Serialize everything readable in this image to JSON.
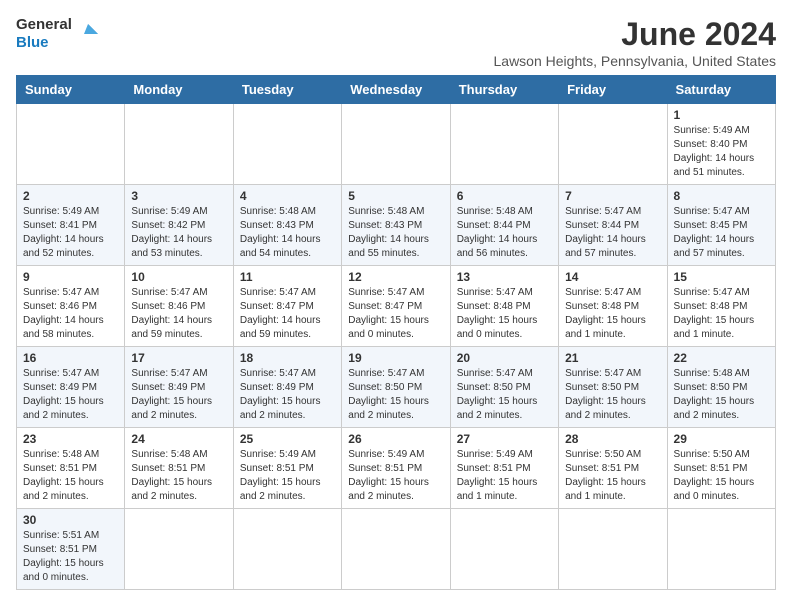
{
  "header": {
    "logo_general": "General",
    "logo_blue": "Blue",
    "month_year": "June 2024",
    "location": "Lawson Heights, Pennsylvania, United States"
  },
  "weekdays": [
    "Sunday",
    "Monday",
    "Tuesday",
    "Wednesday",
    "Thursday",
    "Friday",
    "Saturday"
  ],
  "weeks": [
    [
      {
        "day": "",
        "info": ""
      },
      {
        "day": "",
        "info": ""
      },
      {
        "day": "",
        "info": ""
      },
      {
        "day": "",
        "info": ""
      },
      {
        "day": "",
        "info": ""
      },
      {
        "day": "",
        "info": ""
      },
      {
        "day": "1",
        "info": "Sunrise: 5:49 AM\nSunset: 8:40 PM\nDaylight: 14 hours and 51 minutes."
      }
    ],
    [
      {
        "day": "2",
        "info": "Sunrise: 5:49 AM\nSunset: 8:41 PM\nDaylight: 14 hours and 52 minutes."
      },
      {
        "day": "3",
        "info": "Sunrise: 5:49 AM\nSunset: 8:42 PM\nDaylight: 14 hours and 53 minutes."
      },
      {
        "day": "4",
        "info": "Sunrise: 5:48 AM\nSunset: 8:43 PM\nDaylight: 14 hours and 54 minutes."
      },
      {
        "day": "5",
        "info": "Sunrise: 5:48 AM\nSunset: 8:43 PM\nDaylight: 14 hours and 55 minutes."
      },
      {
        "day": "6",
        "info": "Sunrise: 5:48 AM\nSunset: 8:44 PM\nDaylight: 14 hours and 56 minutes."
      },
      {
        "day": "7",
        "info": "Sunrise: 5:47 AM\nSunset: 8:44 PM\nDaylight: 14 hours and 57 minutes."
      },
      {
        "day": "8",
        "info": "Sunrise: 5:47 AM\nSunset: 8:45 PM\nDaylight: 14 hours and 57 minutes."
      }
    ],
    [
      {
        "day": "9",
        "info": "Sunrise: 5:47 AM\nSunset: 8:46 PM\nDaylight: 14 hours and 58 minutes."
      },
      {
        "day": "10",
        "info": "Sunrise: 5:47 AM\nSunset: 8:46 PM\nDaylight: 14 hours and 59 minutes."
      },
      {
        "day": "11",
        "info": "Sunrise: 5:47 AM\nSunset: 8:47 PM\nDaylight: 14 hours and 59 minutes."
      },
      {
        "day": "12",
        "info": "Sunrise: 5:47 AM\nSunset: 8:47 PM\nDaylight: 15 hours and 0 minutes."
      },
      {
        "day": "13",
        "info": "Sunrise: 5:47 AM\nSunset: 8:48 PM\nDaylight: 15 hours and 0 minutes."
      },
      {
        "day": "14",
        "info": "Sunrise: 5:47 AM\nSunset: 8:48 PM\nDaylight: 15 hours and 1 minute."
      },
      {
        "day": "15",
        "info": "Sunrise: 5:47 AM\nSunset: 8:48 PM\nDaylight: 15 hours and 1 minute."
      }
    ],
    [
      {
        "day": "16",
        "info": "Sunrise: 5:47 AM\nSunset: 8:49 PM\nDaylight: 15 hours and 2 minutes."
      },
      {
        "day": "17",
        "info": "Sunrise: 5:47 AM\nSunset: 8:49 PM\nDaylight: 15 hours and 2 minutes."
      },
      {
        "day": "18",
        "info": "Sunrise: 5:47 AM\nSunset: 8:49 PM\nDaylight: 15 hours and 2 minutes."
      },
      {
        "day": "19",
        "info": "Sunrise: 5:47 AM\nSunset: 8:50 PM\nDaylight: 15 hours and 2 minutes."
      },
      {
        "day": "20",
        "info": "Sunrise: 5:47 AM\nSunset: 8:50 PM\nDaylight: 15 hours and 2 minutes."
      },
      {
        "day": "21",
        "info": "Sunrise: 5:47 AM\nSunset: 8:50 PM\nDaylight: 15 hours and 2 minutes."
      },
      {
        "day": "22",
        "info": "Sunrise: 5:48 AM\nSunset: 8:50 PM\nDaylight: 15 hours and 2 minutes."
      }
    ],
    [
      {
        "day": "23",
        "info": "Sunrise: 5:48 AM\nSunset: 8:51 PM\nDaylight: 15 hours and 2 minutes."
      },
      {
        "day": "24",
        "info": "Sunrise: 5:48 AM\nSunset: 8:51 PM\nDaylight: 15 hours and 2 minutes."
      },
      {
        "day": "25",
        "info": "Sunrise: 5:49 AM\nSunset: 8:51 PM\nDaylight: 15 hours and 2 minutes."
      },
      {
        "day": "26",
        "info": "Sunrise: 5:49 AM\nSunset: 8:51 PM\nDaylight: 15 hours and 2 minutes."
      },
      {
        "day": "27",
        "info": "Sunrise: 5:49 AM\nSunset: 8:51 PM\nDaylight: 15 hours and 1 minute."
      },
      {
        "day": "28",
        "info": "Sunrise: 5:50 AM\nSunset: 8:51 PM\nDaylight: 15 hours and 1 minute."
      },
      {
        "day": "29",
        "info": "Sunrise: 5:50 AM\nSunset: 8:51 PM\nDaylight: 15 hours and 0 minutes."
      }
    ],
    [
      {
        "day": "30",
        "info": "Sunrise: 5:51 AM\nSunset: 8:51 PM\nDaylight: 15 hours and 0 minutes."
      },
      {
        "day": "",
        "info": ""
      },
      {
        "day": "",
        "info": ""
      },
      {
        "day": "",
        "info": ""
      },
      {
        "day": "",
        "info": ""
      },
      {
        "day": "",
        "info": ""
      },
      {
        "day": "",
        "info": ""
      }
    ]
  ]
}
